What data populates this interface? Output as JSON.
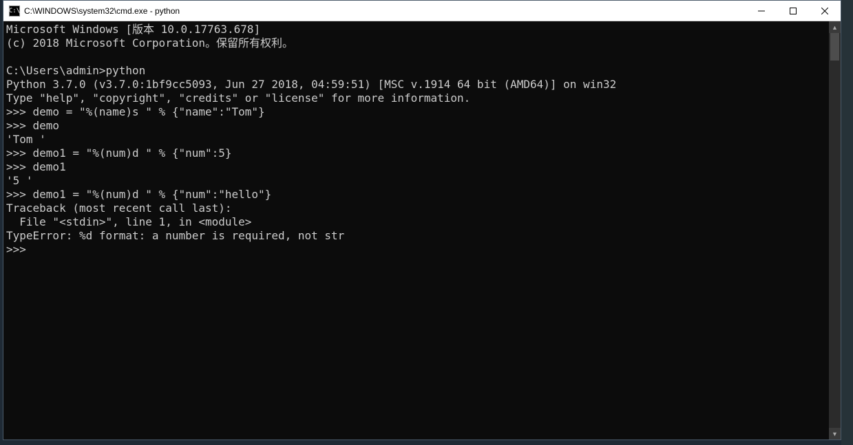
{
  "window": {
    "icon_text": "C:\\",
    "title": "C:\\WINDOWS\\system32\\cmd.exe - python"
  },
  "terminal": {
    "lines": [
      "Microsoft Windows [版本 10.0.17763.678]",
      "(c) 2018 Microsoft Corporation。保留所有权利。",
      "",
      "C:\\Users\\admin>python",
      "Python 3.7.0 (v3.7.0:1bf9cc5093, Jun 27 2018, 04:59:51) [MSC v.1914 64 bit (AMD64)] on win32",
      "Type \"help\", \"copyright\", \"credits\" or \"license\" for more information.",
      ">>> demo = \"%(name)s \" % {\"name\":\"Tom\"}",
      ">>> demo",
      "'Tom '",
      ">>> demo1 = \"%(num)d \" % {\"num\":5}",
      ">>> demo1",
      "'5 '",
      ">>> demo1 = \"%(num)d \" % {\"num\":\"hello\"}",
      "Traceback (most recent call last):",
      "  File \"<stdin>\", line 1, in <module>",
      "TypeError: %d format: a number is required, not str",
      ">>>"
    ]
  },
  "scrollbar": {
    "up_glyph": "▲",
    "down_glyph": "▼"
  }
}
